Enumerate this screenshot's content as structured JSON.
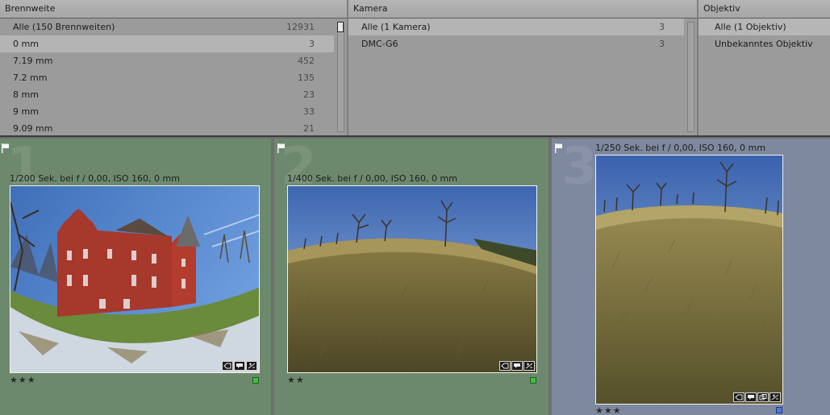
{
  "filter": {
    "columns": [
      {
        "title": "Brennweite",
        "rows": [
          {
            "label": "Alle (150 Brennweiten)",
            "count": "12931"
          },
          {
            "label": "0 mm",
            "count": "3"
          },
          {
            "label": "7.19 mm",
            "count": "452"
          },
          {
            "label": "7.2 mm",
            "count": "135"
          },
          {
            "label": "8 mm",
            "count": "23"
          },
          {
            "label": "9 mm",
            "count": "33"
          },
          {
            "label": "9.09 mm",
            "count": "21"
          }
        ]
      },
      {
        "title": "Kamera",
        "rows": [
          {
            "label": "Alle (1 Kamera)",
            "count": "3"
          },
          {
            "label": "DMC-G6",
            "count": "3"
          }
        ]
      },
      {
        "title": "Objektiv",
        "rows": [
          {
            "label": "Alle (1 Objektiv)"
          },
          {
            "label": "Unbekanntes Objektiv"
          }
        ]
      }
    ]
  },
  "grid": {
    "cells": [
      {
        "number": "1",
        "meta": "1/200 Sek. bei f / 0,00, ISO 160, 0 mm",
        "stars": "★★★",
        "label_color": "#3fbf3f"
      },
      {
        "number": "2",
        "meta": "1/400 Sek. bei f / 0,00, ISO 160, 0 mm",
        "stars": "★★",
        "label_color": "#3fbf3f"
      },
      {
        "number": "3",
        "meta": "1/250 Sek. bei f / 0,00, ISO 160, 0 mm",
        "stars": "★★★",
        "label_color": "#4a7ae0"
      }
    ]
  }
}
